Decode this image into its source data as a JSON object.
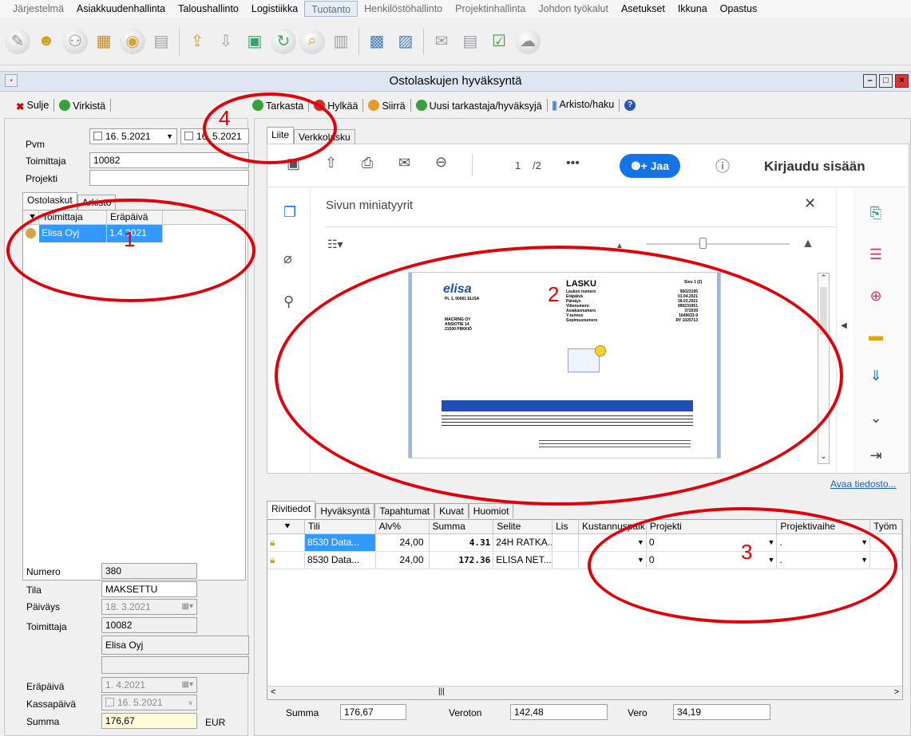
{
  "menu": [
    "Järjestelmä",
    "Asiakkuudenhallinta",
    "Taloushallinto",
    "Logistiikka",
    "Tuotanto",
    "Henkilöstöhallinto",
    "Projektinhallinta",
    "Johdon työkalut",
    "Asetukset",
    "Ikkuna",
    "Opastus"
  ],
  "window": {
    "title": "Ostolaskujen hyväksyntä"
  },
  "left_cmd": {
    "close": "Sulje",
    "refresh": "Virkistä"
  },
  "right_cmd": {
    "check": "Tarkasta",
    "reject": "Hylkää",
    "move": "Siirrä",
    "new_checker": "Uusi tarkastaja/hyväksyjä",
    "archive": "Arkisto/haku"
  },
  "filter": {
    "pvm_label": "Pvm",
    "date_from": "16. 5.2021",
    "date_to": "16. 5.2021",
    "supplier_label": "Toimittaja",
    "supplier_value": "10082",
    "project_label": "Projekti",
    "project_value": ""
  },
  "left_tabs": [
    "Ostolaskut",
    "Arkisto"
  ],
  "invoice_list": {
    "headers": [
      "Toimittaja",
      "Eräpäivä"
    ],
    "rows": [
      {
        "supplier": "Elisa Oyj",
        "due": "1.4.2021"
      }
    ]
  },
  "details": {
    "numero_label": "Numero",
    "numero": "380",
    "tila_label": "Tila",
    "tila": "MAKSETTU",
    "paivays_label": "Päiväys",
    "paivays": "18. 3.2021",
    "toimittaja_label": "Toimittaja",
    "toimittaja": "10082",
    "toimittaja_name": "Elisa Oyj",
    "erapaiva_label": "Eräpäivä",
    "erapaiva": "1. 4.2021",
    "kassapaiva_label": "Kassapäivä",
    "kassapaiva": "16. 5.2021",
    "summa_label": "Summa",
    "summa": "176,67",
    "currency": "EUR"
  },
  "doc_tabs": [
    "Liite",
    "Verkkolasku"
  ],
  "pdf": {
    "page": "1",
    "pages": "/2",
    "share": "Jaa",
    "login": "Kirjaudu sisään",
    "thumb_title": "Sivun miniatyyrit",
    "open_file": "Avaa tiedosto..."
  },
  "invoice_doc": {
    "logo": "elisa",
    "logo_sub": "PL 1, 00061 ELISA",
    "title": "LASKU",
    "page_no": "Sivu 1 (2)",
    "fields": [
      [
        "Laskun numero",
        "95023195"
      ],
      [
        "Eräpäivä",
        "01.04.2021"
      ],
      [
        "Päiväys",
        "18.03.2021"
      ],
      [
        "Viitenumero",
        "990231951"
      ],
      [
        "Asiakasnumero",
        "372039"
      ],
      [
        "Y-tunnus",
        "1649633-9"
      ],
      [
        "Sopimusnumero",
        "RY 1025713"
      ]
    ],
    "recipient": [
      "MACRING OY",
      "ANSIOTIE 14",
      "21500 PIIKKIÖ"
    ]
  },
  "bottom_tabs": [
    "Rivitiedot",
    "Hyväksyntä",
    "Tapahtumat",
    "Kuvat",
    "Huomiot"
  ],
  "rows_grid": {
    "headers": [
      "Tili",
      "Alv%",
      "Summa",
      "Selite",
      "Lis",
      "Kustannuspaik",
      "Projekti",
      "Projektivaihe",
      "Työm"
    ],
    "rows": [
      {
        "tili": "8530 Data...",
        "alv": "24,00",
        "summa": "4.31",
        "selite": "24H RATKA...",
        "projekti": "0",
        "vaihe": "."
      },
      {
        "tili": "8530 Data...",
        "alv": "24,00",
        "summa": "172.36",
        "selite": "ELISA NET...",
        "projekti": "0",
        "vaihe": "."
      }
    ]
  },
  "totals": {
    "summa_label": "Summa",
    "summa": "176,67",
    "veroton_label": "Veroton",
    "veroton": "142,48",
    "vero_label": "Vero",
    "vero": "34,19"
  },
  "annotations": [
    "1",
    "2",
    "3",
    "4"
  ],
  "colors": {
    "annotation": "#e0000a",
    "selection": "#3399ff",
    "share_button": "#1473e6"
  }
}
